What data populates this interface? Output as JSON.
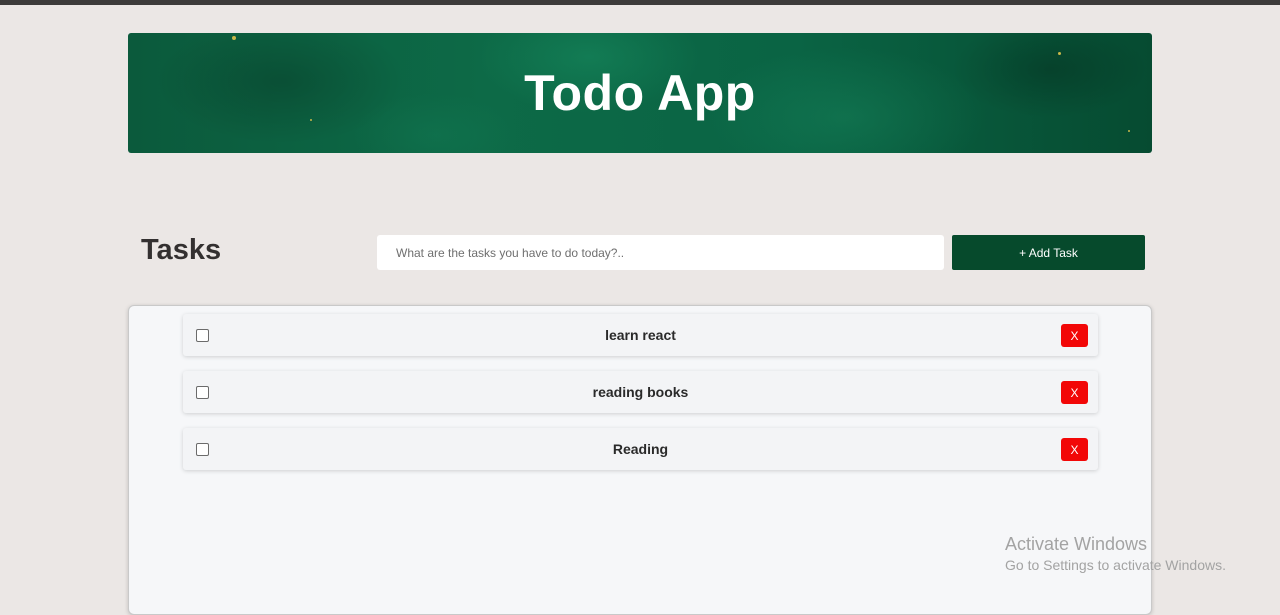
{
  "header": {
    "title": "Todo App"
  },
  "toolbar": {
    "heading": "Tasks",
    "input_placeholder": "What are the tasks you have to do today?..",
    "input_value": "",
    "add_label": "+ Add Task"
  },
  "tasks": [
    {
      "text": "learn react",
      "checked": false,
      "delete_label": "X"
    },
    {
      "text": "reading books",
      "checked": false,
      "delete_label": "X"
    },
    {
      "text": "Reading",
      "checked": false,
      "delete_label": "X"
    }
  ],
  "watermark": {
    "title": "Activate Windows",
    "subtitle": "Go to Settings to activate Windows."
  },
  "colors": {
    "banner_green": "#0b5a3c",
    "add_button": "#064a2c",
    "delete_button": "#f20707",
    "page_background": "#ebe7e5"
  }
}
